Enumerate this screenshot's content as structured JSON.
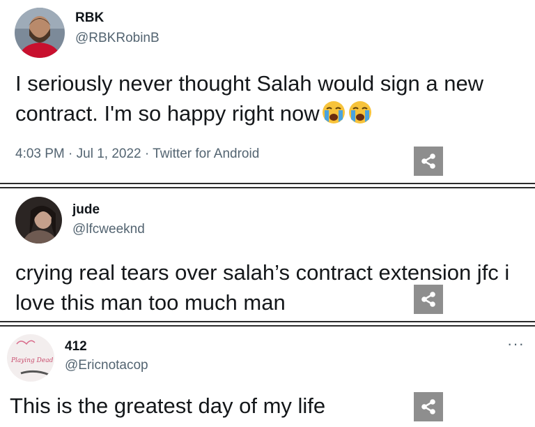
{
  "tweets": [
    {
      "name": "RBK",
      "handle": "@RBKRobinB",
      "text": "I seriously never thought Salah would sign a new contract. I'm so happy right now",
      "emoji": [
        "😭",
        "😭"
      ],
      "meta": "4:03 PM · Jul 1, 2022 · Twitter for Android"
    },
    {
      "name": "jude",
      "handle": "@lfcweeknd",
      "text": "crying real tears over salah’s contract extension jfc i love this man too much man"
    },
    {
      "name": "412",
      "handle": "@Ericnotacop",
      "text": "This is the greatest day of my life",
      "more": "···",
      "avatar_text": "Playing Dead"
    }
  ],
  "icons": {
    "share": "share-icon",
    "emoji": "loudly-crying-face"
  },
  "colors": {
    "share_bg": "#8e8e8e",
    "handle": "#536471",
    "text": "#14171a"
  }
}
